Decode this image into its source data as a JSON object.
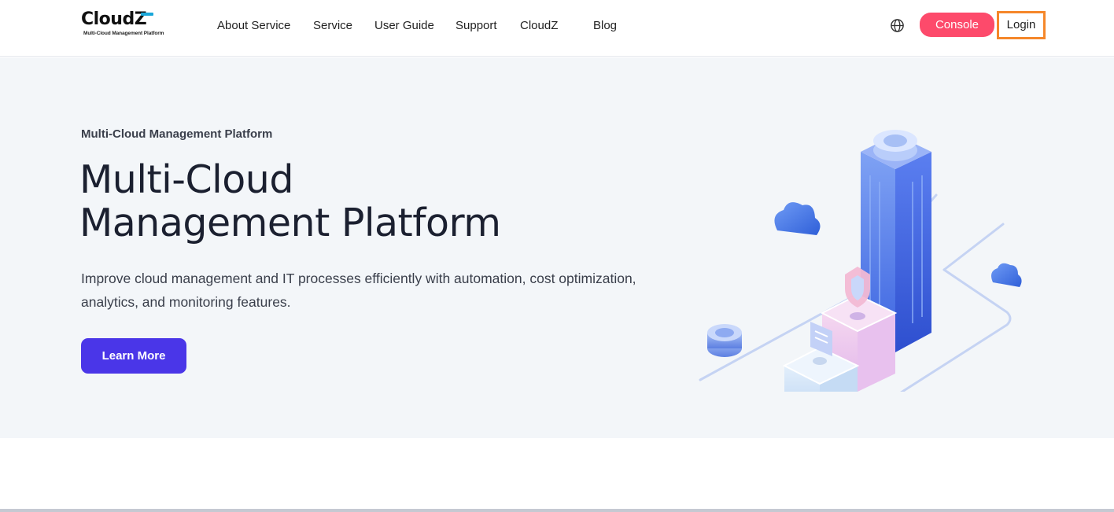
{
  "header": {
    "logo": {
      "word": "CloudZ",
      "word_main": "Cloud",
      "word_z": "Z",
      "tagline": "Multi-Cloud Management Platform"
    },
    "nav": [
      {
        "label": "About Service"
      },
      {
        "label": "Service"
      },
      {
        "label": "User Guide"
      },
      {
        "label": "Support"
      },
      {
        "label": "CloudZ"
      },
      {
        "label": "Blog"
      }
    ],
    "language_icon": "globe-icon",
    "console_label": "Console",
    "login_label": "Login"
  },
  "hero": {
    "eyebrow": "Multi-Cloud Management Platform",
    "title_line1": "Multi-Cloud",
    "title_line2": "Management Platform",
    "description": "Improve cloud management and IT processes efficiently with automation, cost optimization, analytics, and monitoring features.",
    "cta_label": "Learn More"
  },
  "colors": {
    "console": "#fd4a6b",
    "login_outline": "#f5872a",
    "cta": "#4a36e8",
    "hero_bg": "#f3f6f9",
    "logo_accent": "#1aa7d9"
  }
}
